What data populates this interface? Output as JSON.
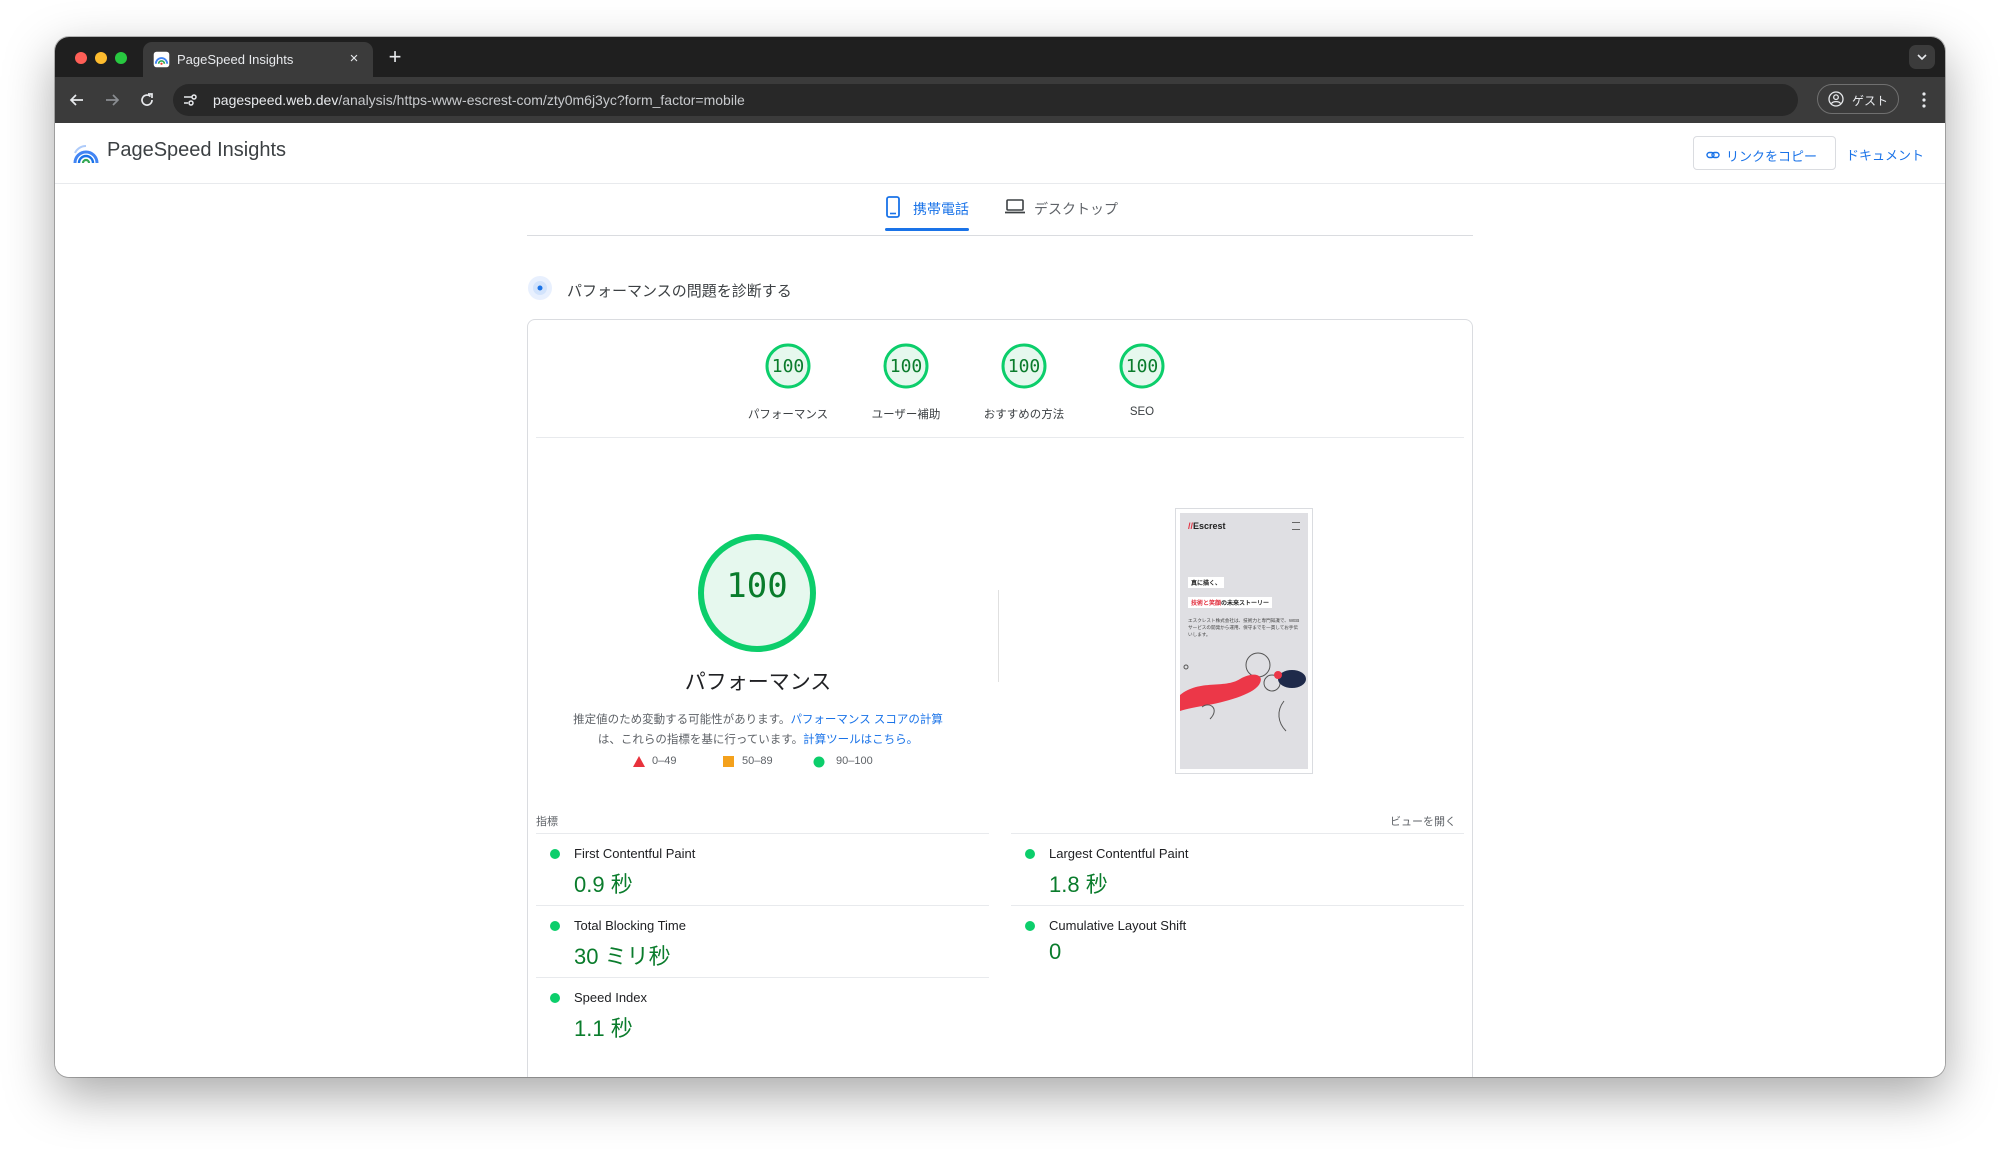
{
  "browser": {
    "tab_title": "PageSpeed Insights",
    "new_tab_symbol": "+",
    "close_symbol": "×",
    "url_host": "pagespeed.web.dev",
    "url_rest": "/analysis/https-www-escrest-com/zty0m6j3yc?form_factor=mobile",
    "profile_label": "ゲスト"
  },
  "header": {
    "app_name": "PageSpeed Insights",
    "copy_link_label": "リンクをコピー",
    "docs_label": "ドキュメント"
  },
  "device_tabs": [
    {
      "label": "携帯電話",
      "active": true,
      "icon": "smartphone-icon"
    },
    {
      "label": "デスクトップ",
      "active": false,
      "icon": "laptop-icon"
    }
  ],
  "diagnose_label": "パフォーマンスの問題を診断する",
  "categories": [
    {
      "score": "100",
      "label": "パフォーマンス"
    },
    {
      "score": "100",
      "label": "ユーザー補助"
    },
    {
      "score": "100",
      "label": "おすすめの方法"
    },
    {
      "score": "100",
      "label": "SEO"
    }
  ],
  "performance": {
    "score": "100",
    "title": "パフォーマンス",
    "desc_prefix": "推定値のため変動する可能性があります。",
    "desc_link1": "パフォーマンス スコアの計算",
    "desc_mid": "は、これらの指標を基に行っています。",
    "desc_link2": "計算ツールはこちら。"
  },
  "legend": [
    {
      "range": "0–49",
      "color": "#e8323c",
      "shape": "triangle"
    },
    {
      "range": "50–89",
      "color": "#f4a11c",
      "shape": "square"
    },
    {
      "range": "90–100",
      "color": "#0cce6b",
      "shape": "circle"
    }
  ],
  "screenshot": {
    "logo_text": "Escrest",
    "heading1": "真に描く、",
    "heading2_red": "技術と笑顔",
    "heading2_rest": "の未来ストーリー",
    "paragraph": "エスクレスト株式会社は、技術力と専門知識で、WEBサービスの開発から運用、保守までを一貫してお手伝いします。"
  },
  "metrics_header": {
    "left": "指標",
    "right": "ビューを開く"
  },
  "metrics": [
    {
      "title": "First Contentful Paint",
      "value": "0.9 秒"
    },
    {
      "title": "Largest Contentful Paint",
      "value": "1.8 秒"
    },
    {
      "title": "Total Blocking Time",
      "value": "30 ミリ秒"
    },
    {
      "title": "Cumulative Layout Shift",
      "value": "0"
    },
    {
      "title": "Speed Index",
      "value": "1.1 秒"
    }
  ],
  "colors": {
    "pass_green": "#0cce6b",
    "pass_text": "#0a7c2c",
    "link_blue": "#1a73e8"
  }
}
